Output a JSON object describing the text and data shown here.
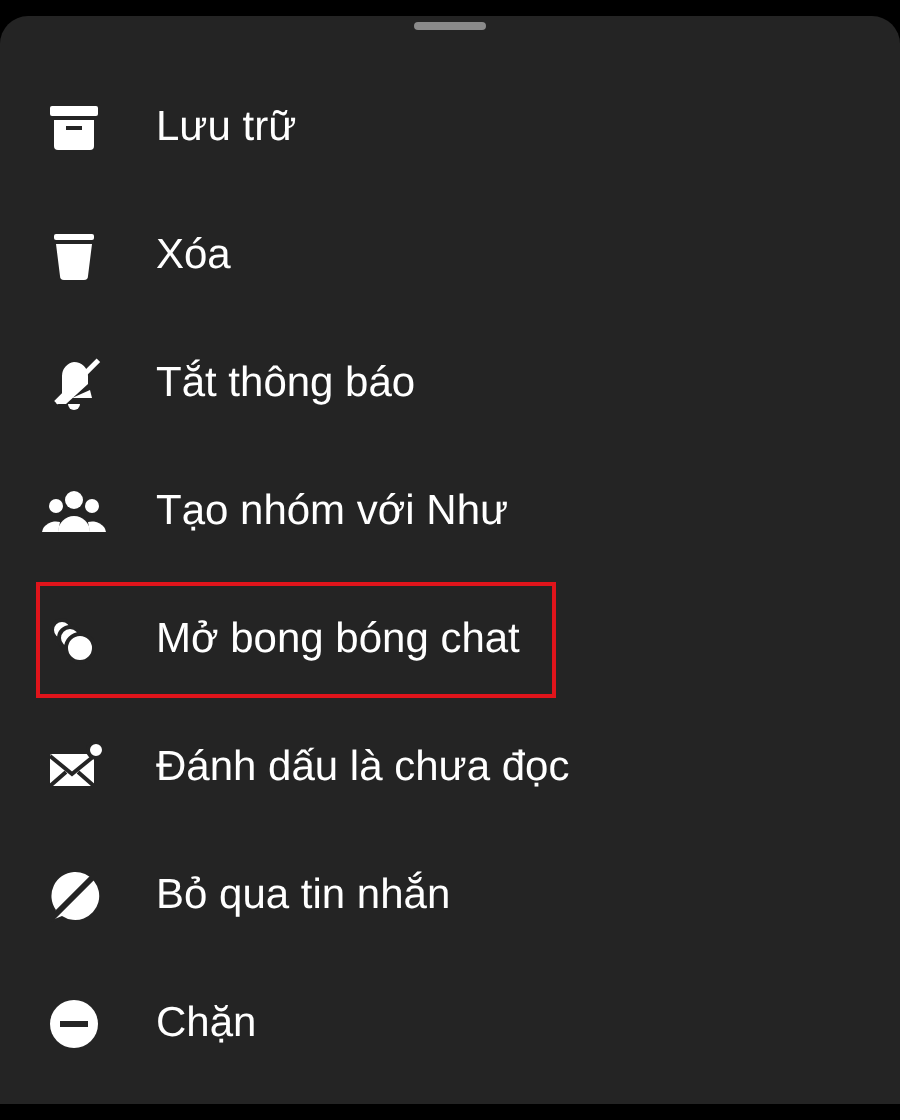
{
  "menu": {
    "items": [
      {
        "kind": "archive",
        "label": "Lưu trữ",
        "highlighted": false
      },
      {
        "kind": "delete",
        "label": "Xóa",
        "highlighted": false
      },
      {
        "kind": "mute",
        "label": "Tắt thông báo",
        "highlighted": false
      },
      {
        "kind": "group",
        "label": "Tạo nhóm với Như",
        "highlighted": false
      },
      {
        "kind": "bubbles",
        "label": "Mở bong bóng chat",
        "highlighted": true
      },
      {
        "kind": "unread",
        "label": "Đánh dấu là chưa đọc",
        "highlighted": false
      },
      {
        "kind": "ignore",
        "label": "Bỏ qua tin nhắn",
        "highlighted": false
      },
      {
        "kind": "block",
        "label": "Chặn",
        "highlighted": false
      }
    ]
  }
}
